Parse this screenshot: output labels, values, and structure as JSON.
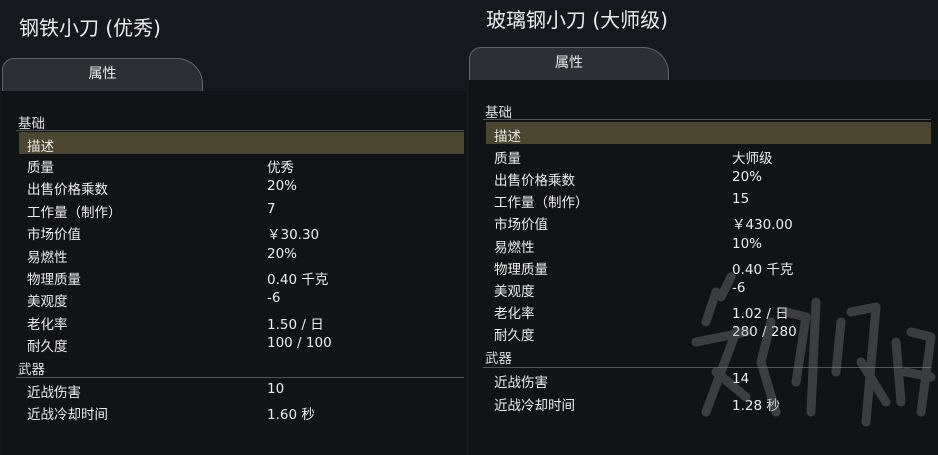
{
  "left": {
    "title": "钢铁小刀 (优秀)",
    "tab_label": "属性",
    "sections": {
      "basic": "基础",
      "weapon": "武器"
    },
    "rows": [
      {
        "key": "描述",
        "value": ""
      },
      {
        "key": "质量",
        "value": "优秀"
      },
      {
        "key": "出售价格乘数",
        "value": "20%"
      },
      {
        "key": "工作量（制作）",
        "value": "7"
      },
      {
        "key": "市场价值",
        "value": "￥30.30"
      },
      {
        "key": "易燃性",
        "value": "20%"
      },
      {
        "key": "物理质量",
        "value": "0.40 千克"
      },
      {
        "key": "美观度",
        "value": "-6"
      },
      {
        "key": "老化率",
        "value": "1.50 / 日"
      },
      {
        "key": "耐久度",
        "value": "100 / 100"
      },
      {
        "key": "近战伤害",
        "value": "10"
      },
      {
        "key": "近战冷却时间",
        "value": "1.60 秒"
      }
    ]
  },
  "right": {
    "title": "玻璃钢小刀 (大师级)",
    "tab_label": "属性",
    "sections": {
      "basic": "基础",
      "weapon": "武器"
    },
    "rows": [
      {
        "key": "描述",
        "value": ""
      },
      {
        "key": "质量",
        "value": "大师级"
      },
      {
        "key": "出售价格乘数",
        "value": "20%"
      },
      {
        "key": "工作量（制作）",
        "value": "15"
      },
      {
        "key": "市场价值",
        "value": "￥430.00"
      },
      {
        "key": "易燃性",
        "value": "10%"
      },
      {
        "key": "物理质量",
        "value": "0.40 千克"
      },
      {
        "key": "美观度",
        "value": "-6"
      },
      {
        "key": "老化率",
        "value": "1.02 / 日"
      },
      {
        "key": "耐久度",
        "value": "280 / 280"
      },
      {
        "key": "近战伤害",
        "value": "14"
      },
      {
        "key": "近战冷却时间",
        "value": "1.28 秒"
      }
    ]
  },
  "colors": {
    "background": "#15191e",
    "highlight_row": "#4a4630",
    "tab": "#2c3035"
  }
}
